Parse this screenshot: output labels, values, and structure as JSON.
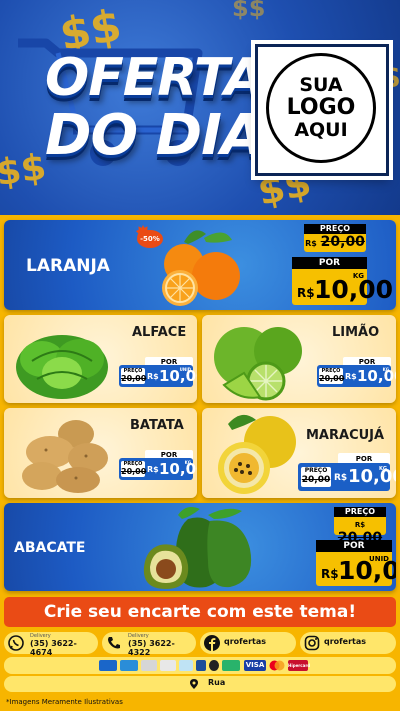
{
  "header": {
    "title_line1": "OFERTA",
    "title_line2": "DO DIA",
    "logo_line1": "SUA",
    "logo_line2": "LOGO",
    "logo_line3": "AQUI",
    "money_symbol": "$$"
  },
  "products": {
    "laranja": {
      "name": "LARANJA",
      "discount": "-50%",
      "preco_label": "PREÇO",
      "old_price": "20,00",
      "old_currency": "R$",
      "por_label": "POR",
      "currency": "R$",
      "price": "10,00",
      "unit": "KG"
    },
    "alface": {
      "name": "ALFACE",
      "preco_label": "PREÇO",
      "old_price": "20,00",
      "old_currency": "R$",
      "por_label": "POR",
      "currency": "R$",
      "price": "10,00",
      "unit": "UNID"
    },
    "limao": {
      "name": "LIMÃO",
      "preco_label": "PREÇO",
      "old_price": "20,00",
      "old_currency": "R$",
      "por_label": "POR",
      "currency": "R$",
      "price": "10,00",
      "unit": "KG"
    },
    "batata": {
      "name": "BATATA",
      "preco_label": "PREÇO",
      "old_price": "20,00",
      "old_currency": "R$",
      "por_label": "POR",
      "currency": "R$",
      "price": "10,00",
      "unit": "KG"
    },
    "maracuja": {
      "name": "MARACUJÁ",
      "preco_label": "PREÇO",
      "old_price": "20,00",
      "old_currency": "R$",
      "por_label": "POR",
      "currency": "R$",
      "price": "10,00",
      "unit": "KG"
    },
    "abacate": {
      "name": "ABACATE",
      "preco_label": "PREÇO",
      "old_price": "20,00",
      "old_currency": "R$",
      "por_label": "POR",
      "currency": "R$",
      "price": "10,00",
      "unit": "UNID"
    }
  },
  "banner": {
    "text": "Crie seu encarte com este tema!"
  },
  "contacts": {
    "whatsapp": {
      "label": "Delivery",
      "value": "(35) 3622-4674"
    },
    "phone": {
      "label": "Delivery",
      "value": "(35) 3622-4322"
    },
    "facebook": {
      "value": "qrofertas"
    },
    "instagram": {
      "value": "qrofertas"
    }
  },
  "payment": {
    "visa": "VISA",
    "hipercard": "Hipercard"
  },
  "address": {
    "text": "Rua"
  },
  "disclaimer": "*Imagens Meramente Ilustrativas",
  "colors": {
    "blue": "#1d5bc4",
    "yellow": "#f6c000",
    "orange_banner": "#ea4b15",
    "cream": "#ffe4a6"
  }
}
